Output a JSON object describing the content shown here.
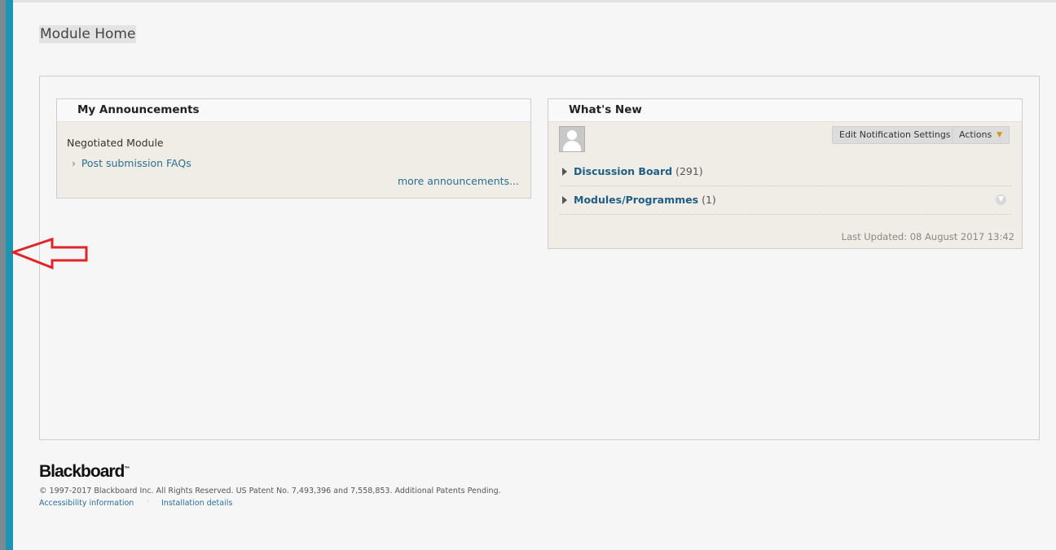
{
  "page": {
    "title": "Module Home"
  },
  "announcements": {
    "heading": "My Announcements",
    "subtitle": "Negotiated Module",
    "items": [
      {
        "label": "Post submission FAQs"
      }
    ],
    "more_link": "more announcements..."
  },
  "whats_new": {
    "heading": "What's New",
    "buttons": {
      "notification_settings": "Edit Notification Settings",
      "actions": "Actions"
    },
    "rows": [
      {
        "label": "Discussion Board",
        "count": "(291)"
      },
      {
        "label": "Modules/Programmes",
        "count": "(1)"
      }
    ],
    "last_updated": "Last Updated: 08 August 2017 13:42"
  },
  "footer": {
    "logo": "Blackboard",
    "copyright": "© 1997-2017 Blackboard Inc. All Rights Reserved. US Patent No. 7,493,396 and 7,558,853. Additional Patents Pending.",
    "links": {
      "accessibility": "Accessibility information",
      "installation": "Installation details"
    },
    "separator": "·"
  },
  "icons": {
    "row_expand": "triangle-right-icon",
    "link_bullet": "chevron-right-icon",
    "actions_menu": "double-chevron-down-icon",
    "row_menu": "circle-chevron-down-icon",
    "annotation_arrow": "arrow-left-icon"
  },
  "colors": {
    "teal_bar": "#1a96b4",
    "link": "#2a6f94",
    "annotation_arrow": "#e0252a"
  }
}
